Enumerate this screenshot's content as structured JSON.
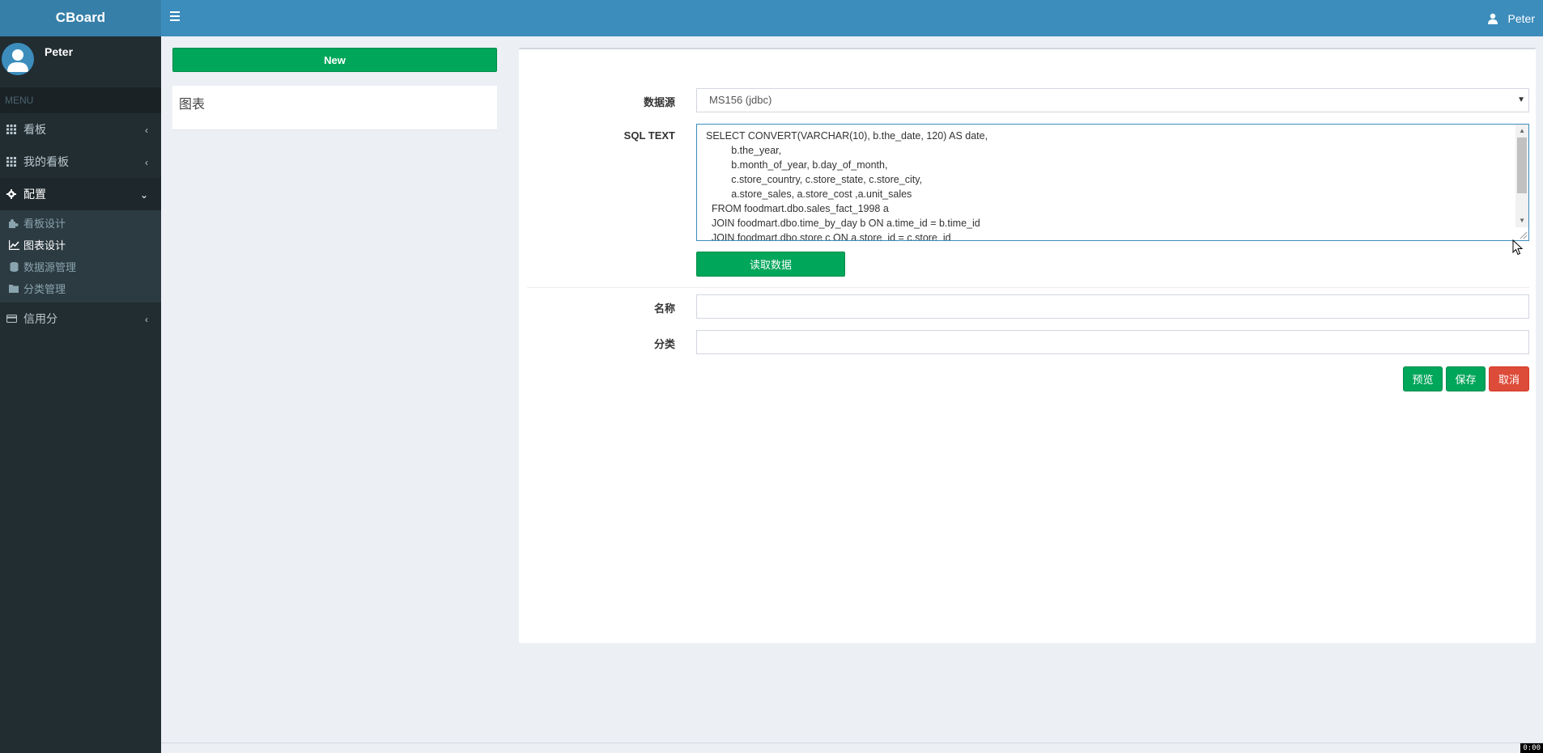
{
  "app": {
    "title": "CBoard"
  },
  "header": {
    "user_name": "Peter"
  },
  "sidebar": {
    "user_name": "Peter",
    "menu_header": "MENU",
    "items": [
      {
        "label": "看板",
        "icon": "grid-icon",
        "expanded": false
      },
      {
        "label": "我的看板",
        "icon": "grid-icon",
        "expanded": false
      },
      {
        "label": "配置",
        "icon": "gear-icon",
        "expanded": true
      },
      {
        "label": "信用分",
        "icon": "credit-card-icon",
        "expanded": false
      }
    ],
    "submenu": [
      {
        "label": "看板设计",
        "icon": "puzzle-icon"
      },
      {
        "label": "图表设计",
        "icon": "line-chart-icon",
        "active": true
      },
      {
        "label": "数据源管理",
        "icon": "database-icon"
      },
      {
        "label": "分类管理",
        "icon": "folder-icon"
      }
    ]
  },
  "list_panel": {
    "new_label": "New",
    "title": "图表"
  },
  "form": {
    "datasource_label": "数据源",
    "datasource_value": "MS156 (jdbc)",
    "sql_label": "SQL TEXT",
    "sql_text": "SELECT CONVERT(VARCHAR(10), b.the_date, 120) AS date,\n         b.the_year,\n         b.month_of_year, b.day_of_month,\n         c.store_country, c.store_state, c.store_city,\n         a.store_sales, a.store_cost ,a.unit_sales\n  FROM foodmart.dbo.sales_fact_1998 a\n  JOIN foodmart.dbo.time_by_day b ON a.time_id = b.time_id\n  JOIN foodmart.dbo.store c ON a.store_id = c.store_id",
    "read_button": "读取数据",
    "name_label": "名称",
    "name_value": "",
    "category_label": "分类",
    "category_value": "",
    "preview_button": "预览",
    "save_button": "保存",
    "cancel_button": "取消"
  },
  "status": {
    "timer": "0:00"
  },
  "colors": {
    "header": "#3c8dbc",
    "sidebar": "#222d32",
    "success": "#00a65a",
    "danger": "#dd4b39"
  }
}
